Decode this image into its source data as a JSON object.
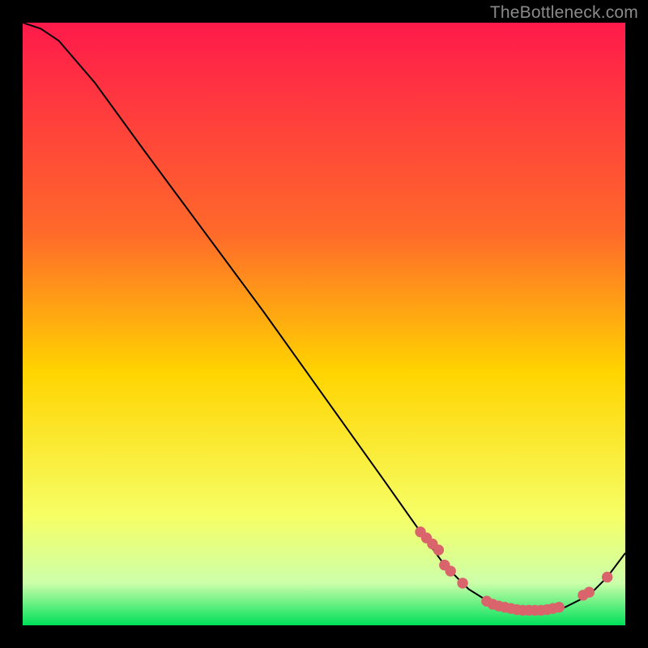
{
  "watermark": "TheBottleneck.com",
  "chart_data": {
    "type": "line",
    "title": "",
    "xlabel": "",
    "ylabel": "",
    "xlim": [
      0,
      100
    ],
    "ylim": [
      0,
      100
    ],
    "grid": false,
    "series": [
      {
        "name": "curve",
        "x": [
          0,
          3,
          6,
          12,
          20,
          30,
          40,
          50,
          60,
          66,
          70,
          74,
          78,
          82,
          86,
          90,
          94,
          97,
          100
        ],
        "y": [
          100,
          99,
          97,
          90,
          79,
          65.5,
          52,
          38,
          24,
          15.5,
          10,
          6,
          3.5,
          2.5,
          2.5,
          3,
          5,
          8,
          12
        ]
      }
    ],
    "markers": {
      "x": [
        66,
        67,
        68,
        69,
        70,
        71,
        73,
        77,
        78,
        79,
        80,
        81,
        82,
        83,
        84,
        85,
        86,
        87,
        88,
        89,
        93,
        94,
        97
      ],
      "y": [
        15.5,
        14.5,
        13.5,
        12.5,
        10,
        9,
        7,
        4,
        3.5,
        3.2,
        3,
        2.8,
        2.6,
        2.5,
        2.5,
        2.5,
        2.5,
        2.6,
        2.8,
        3,
        5,
        5.5,
        8
      ]
    },
    "colors": {
      "gradient_top": "#ff1a4b",
      "gradient_upper_mid": "#ff6a2a",
      "gradient_mid": "#ffd400",
      "gradient_lower_mid": "#f6ff66",
      "gradient_low": "#ccffaa",
      "gradient_bottom": "#00e05a",
      "curve": "#000000",
      "marker": "#d9646b"
    }
  }
}
